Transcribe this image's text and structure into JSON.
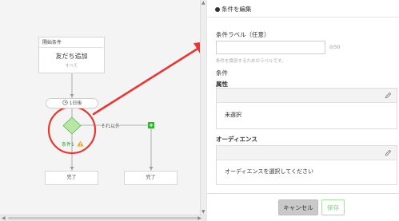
{
  "canvas": {
    "start_node": {
      "header": "開始条件",
      "title": "友だち追加",
      "subtitle": "すべて"
    },
    "wait": {
      "icon": "clock-icon",
      "label": "1日後"
    },
    "condition": {
      "label": "条件1",
      "warning_icon": "warning-icon",
      "label_color": "#2fa52f"
    },
    "else_label": "それ以外",
    "add_icon": "plus-icon",
    "end_nodes": [
      {
        "label": "完了"
      },
      {
        "label": "完了"
      }
    ],
    "highlight_color": "#e53935",
    "diamond_color": "#b7e6a5"
  },
  "panel": {
    "title": "条件を編集",
    "label_field": {
      "label": "条件ラベル（任意）",
      "value": "",
      "counter": "0/50",
      "help": "条件を識別するためのラベルです。"
    },
    "section_title": "条件",
    "attribute": {
      "label": "属性",
      "value": "未選択",
      "edit_icon": "pencil-icon"
    },
    "audience": {
      "label": "オーディエンス",
      "value": "オーディエンスを選択してください",
      "edit_icon": "pencil-icon"
    },
    "buttons": {
      "cancel": "キャンセル",
      "save": "保存"
    }
  }
}
